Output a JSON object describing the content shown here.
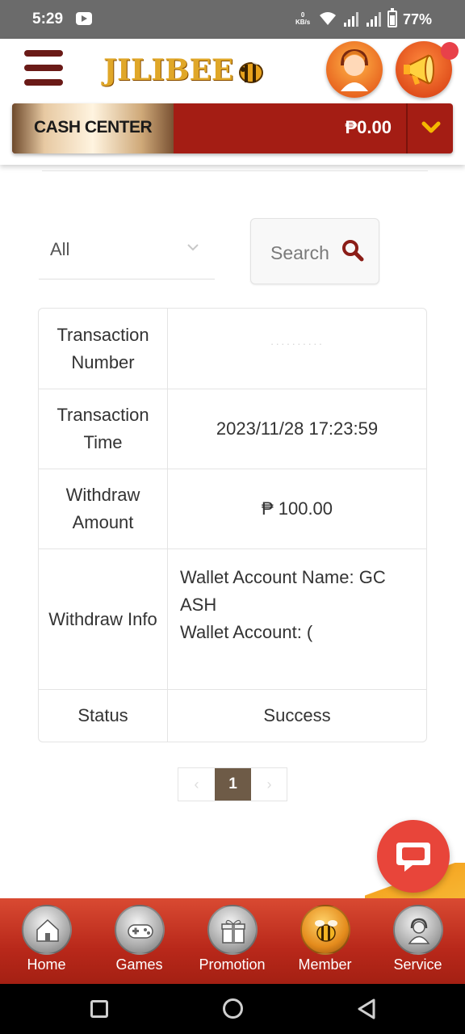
{
  "status_bar": {
    "time": "5:29",
    "speed_value": "0",
    "speed_unit": "KB/s",
    "battery": "77%"
  },
  "header": {
    "logo_text": "JILIBEE",
    "cash_center_label": "CASH CENTER",
    "balance": "₱0.00"
  },
  "filter": {
    "selected": "All",
    "search_label": "Search"
  },
  "details": {
    "rows": [
      {
        "label": "Transaction Number",
        "value": "··········"
      },
      {
        "label": "Transaction Time",
        "value": "2023/11/28 17:23:59"
      },
      {
        "label": "Withdraw Amount",
        "value": "₱ 100.00"
      },
      {
        "label": "Withdraw Info",
        "lines": [
          "Wallet Account Name: GC",
          "ASH",
          "Wallet Account: ("
        ]
      },
      {
        "label": "Status",
        "value": "Success"
      }
    ]
  },
  "pagination": {
    "prev": "‹",
    "current": "1",
    "next": "›"
  },
  "bottom_nav": [
    {
      "label": "Home",
      "icon": "home-icon"
    },
    {
      "label": "Games",
      "icon": "gamepad-icon"
    },
    {
      "label": "Promotion",
      "icon": "gift-icon"
    },
    {
      "label": "Member",
      "icon": "bee-icon"
    },
    {
      "label": "Service",
      "icon": "headset-agent-icon"
    }
  ],
  "colors": {
    "brand_red": "#a41d14",
    "accent_gold": "#e0a728",
    "page_active": "#6e5b47",
    "chat_red": "#e8453a"
  }
}
